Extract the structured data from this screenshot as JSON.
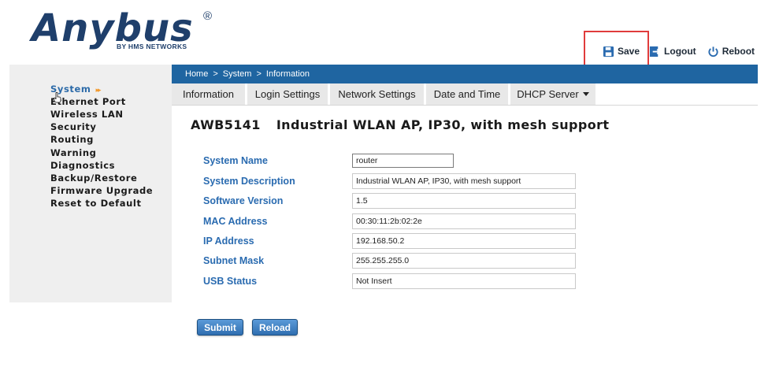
{
  "logo": {
    "word": "Anybus",
    "registered": "®",
    "sub": "BY HMS NETWORKS"
  },
  "top_actions": {
    "save": {
      "label": "Save",
      "icon": "floppy-disk-icon"
    },
    "logout": {
      "label": "Logout",
      "icon": "logout-icon"
    },
    "reboot": {
      "label": "Reboot",
      "icon": "power-icon"
    },
    "highlight_color": "#e03c3c"
  },
  "breadcrumb": [
    "Home",
    "System",
    "Information"
  ],
  "breadcrumb_separator": ">",
  "tabs": [
    {
      "label": "Information",
      "active": true
    },
    {
      "label": "Login Settings"
    },
    {
      "label": "Network Settings"
    },
    {
      "label": "Date and Time"
    },
    {
      "label": "DHCP Server",
      "dropdown": true
    }
  ],
  "sidebar": {
    "items": [
      {
        "label": "System",
        "active": true,
        "arrow": "▸▸"
      },
      {
        "label": "Ethernet Port"
      },
      {
        "label": "Wireless LAN"
      },
      {
        "label": "Security"
      },
      {
        "label": "Routing"
      },
      {
        "label": "Warning"
      },
      {
        "label": "Diagnostics"
      },
      {
        "label": "Backup/Restore"
      },
      {
        "label": "Firmware Upgrade"
      },
      {
        "label": "Reset to Default"
      }
    ]
  },
  "page": {
    "model": "AWB5141",
    "description": "Industrial WLAN AP, IP30, with mesh support"
  },
  "form": {
    "fields": [
      {
        "label": "System Name",
        "value": "router"
      },
      {
        "label": "System Description",
        "value": "Industrial WLAN AP, IP30, with mesh support"
      },
      {
        "label": "Software Version",
        "value": "1.5"
      },
      {
        "label": "MAC Address",
        "value": "00:30:11:2b:02:2e"
      },
      {
        "label": "IP Address",
        "value": "192.168.50.2"
      },
      {
        "label": "Subnet Mask",
        "value": "255.255.255.0"
      },
      {
        "label": "USB Status",
        "value": "Not Insert"
      }
    ]
  },
  "buttons": {
    "submit": "Submit",
    "reload": "Reload"
  },
  "colors": {
    "brand": "#1f3f6b",
    "bar": "#1f65a1",
    "label": "#2a6bb0",
    "accent_arrow": "#f29a2e"
  }
}
